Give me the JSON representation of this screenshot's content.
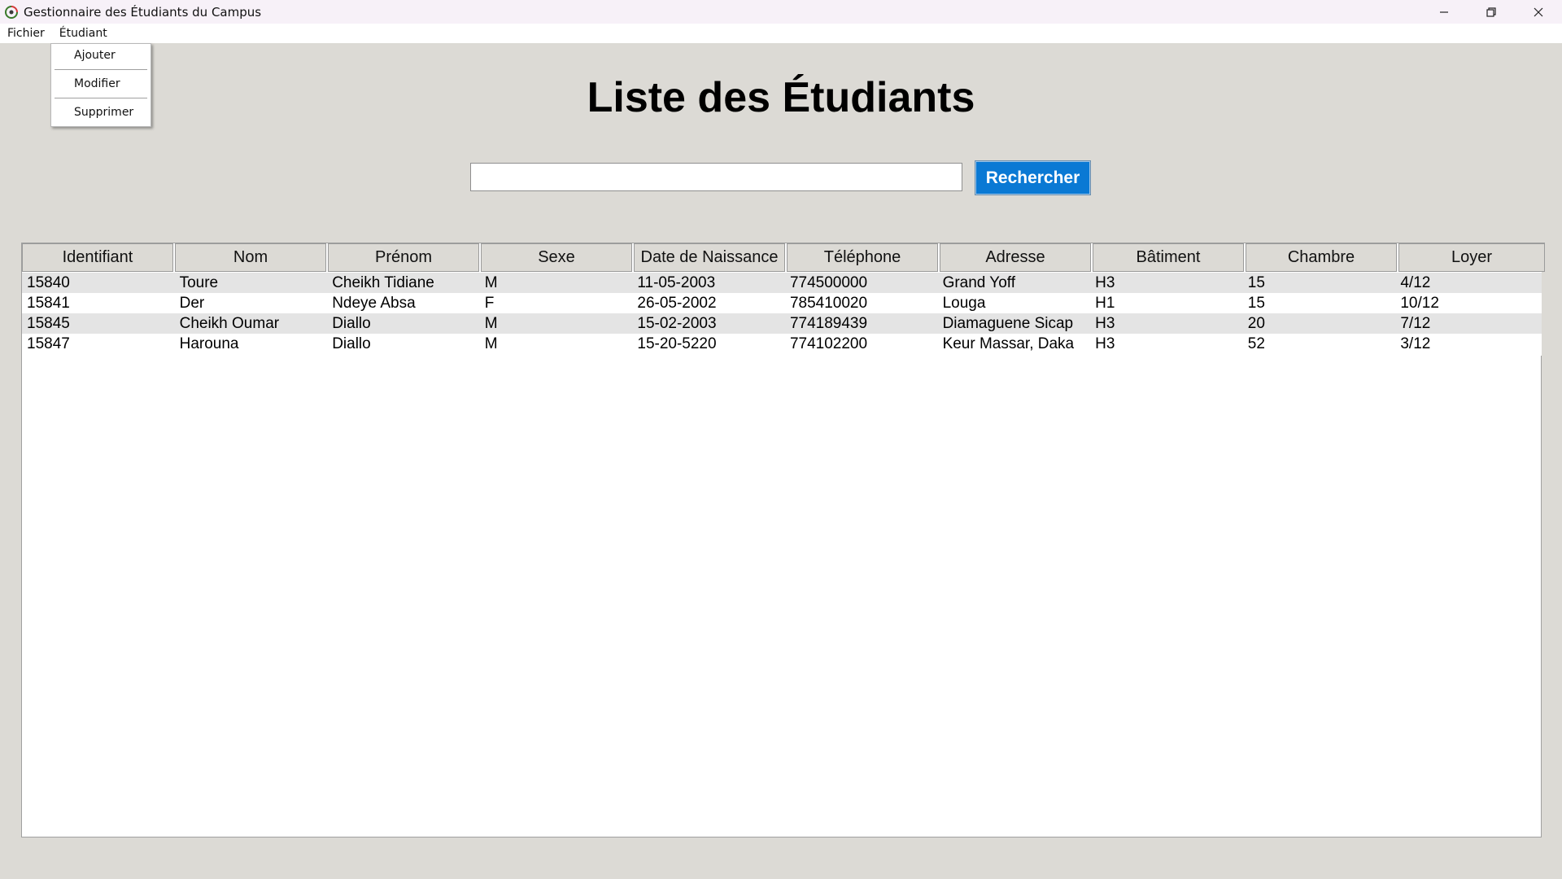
{
  "window": {
    "title": "Gestionnaire des Étudiants du Campus",
    "controls": {
      "minimize": "minimize-icon",
      "restore": "restore-icon",
      "close": "close-icon"
    }
  },
  "menubar": {
    "items": [
      "Fichier",
      "Étudiant"
    ]
  },
  "dropdown": {
    "items": [
      "Ajouter",
      "Modifier",
      "Supprimer"
    ]
  },
  "page": {
    "title": "Liste des Étudiants"
  },
  "search": {
    "value": "",
    "button_label": "Rechercher"
  },
  "colors": {
    "background": "#dcdad5",
    "accent_button": "#0a79d4",
    "row_alt": "#e4e4e4"
  },
  "table": {
    "headers": [
      "Identifiant",
      "Nom",
      "Prénom",
      "Sexe",
      "Date de Naissance",
      "Téléphone",
      "Adresse",
      "Bâtiment",
      "Chambre",
      "Loyer"
    ],
    "rows": [
      [
        "15840",
        "Toure",
        "Cheikh Tidiane",
        "M",
        "11-05-2003",
        "774500000",
        "Grand Yoff",
        "H3",
        "15",
        "4/12"
      ],
      [
        "15841",
        "Der",
        "Ndeye Absa",
        "F",
        "26-05-2002",
        "785410020",
        "Louga",
        "H1",
        "15",
        "10/12"
      ],
      [
        "15845",
        "Cheikh Oumar",
        "Diallo",
        "M",
        "15-02-2003",
        "774189439",
        "Diamaguene Sicap",
        "H3",
        "20",
        "7/12"
      ],
      [
        "15847",
        "Harouna",
        "Diallo",
        "M",
        "15-20-5220",
        "774102200",
        "Keur Massar, Daka",
        "H3",
        "52",
        "3/12"
      ]
    ]
  }
}
